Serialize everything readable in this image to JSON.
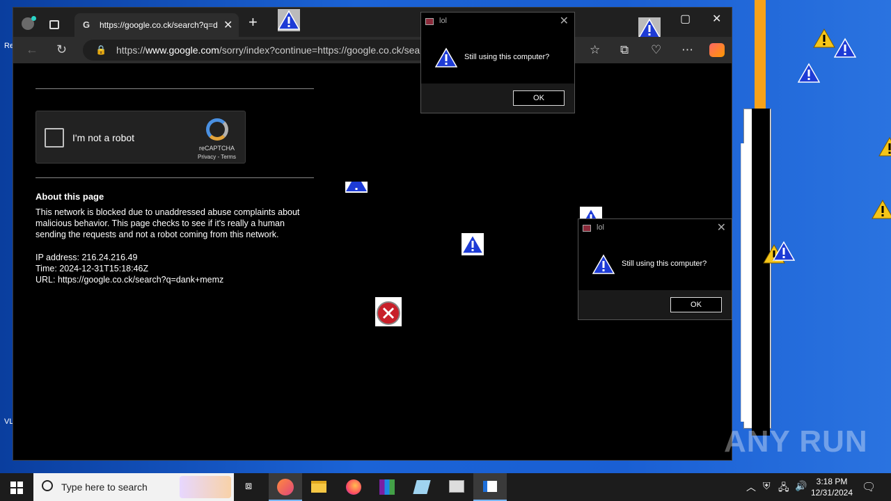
{
  "browser": {
    "tab_title": "https://google.co.ck/search?q=d",
    "url_prefix": "https://",
    "url_host": "www.google.com",
    "url_rest": "/sorry/index?continue=https://google.co.ck/sear"
  },
  "page": {
    "captcha_label": "I'm not a robot",
    "captcha_brand": "reCAPTCHA",
    "captcha_links": "Privacy - Terms",
    "about_title": "About this page",
    "about_text": "This network is blocked due to unaddressed abuse complaints about malicious behavior. This page checks to see if it's really a human sending the requests and not a robot coming from this network.",
    "ip": "IP address: 216.24.216.49",
    "time": "Time: 2024-12-31T15:18:46Z",
    "url": "URL: https://google.co.ck/search?q=dank+memz"
  },
  "dialogs": [
    {
      "title": "lol",
      "message": "Still using this computer?",
      "ok": "OK"
    },
    {
      "title": "lol",
      "message": "Still using this computer?",
      "ok": "OK"
    }
  ],
  "taskbar": {
    "search_placeholder": "Type here to search",
    "time": "3:18 PM",
    "date": "12/31/2024"
  },
  "desktop": {
    "labels": [
      "Re",
      "VL"
    ]
  },
  "watermark": "ANY RUN",
  "colors": {
    "desktop_blue": "#1b63d6",
    "warning_yellow": "#f5c518",
    "taskbar": "#1c1c1c"
  }
}
